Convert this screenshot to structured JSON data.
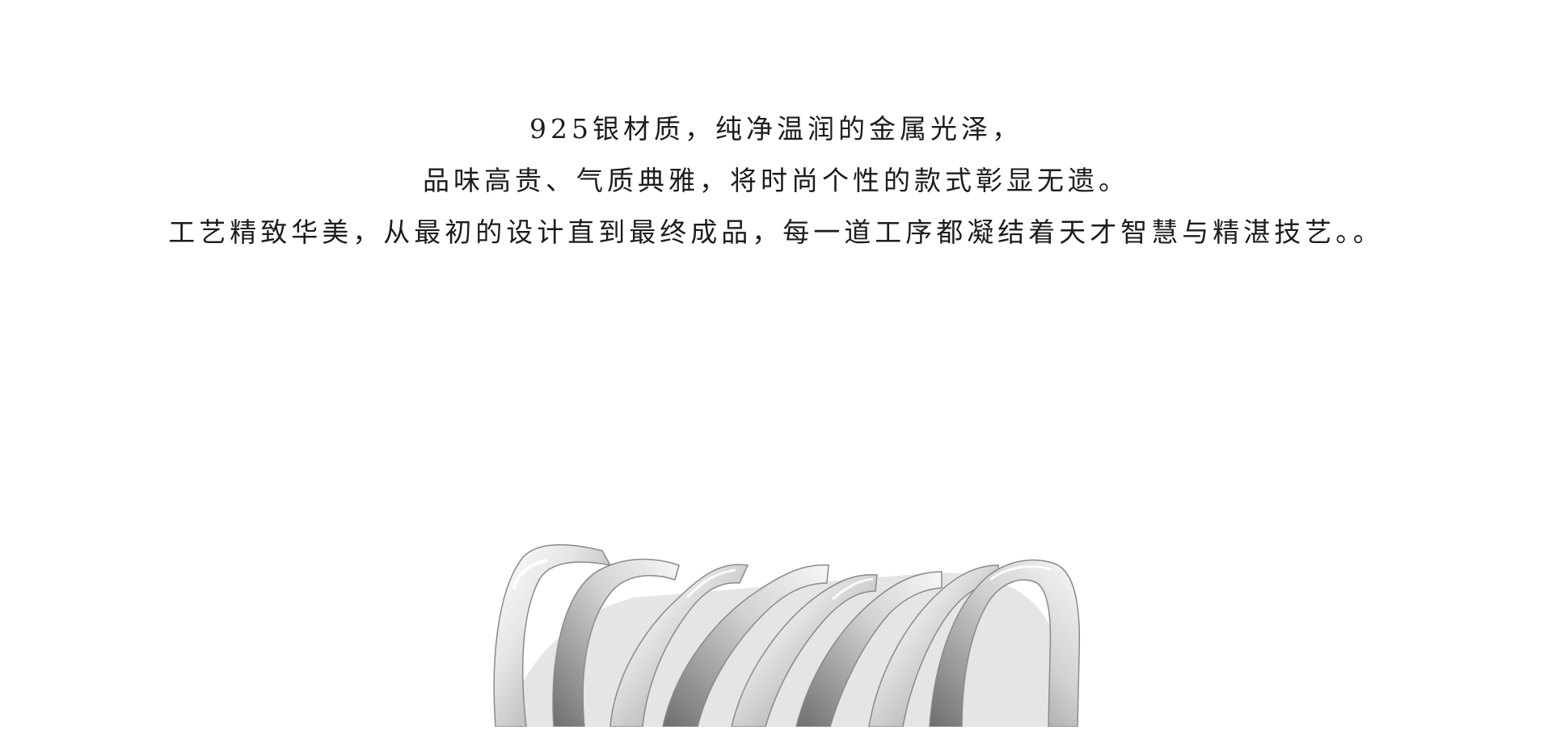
{
  "product_description": {
    "lines": [
      "925银材质，纯净温润的金属光泽，",
      "品味高贵、气质典雅，将时尚个性的款式彰显无遗。",
      "工艺精致华美，从最初的设计直到最终成品，每一道工序都凝结着天才智慧与精湛技艺。。"
    ]
  },
  "product_image": {
    "icon": "silver-wave-ring-icon",
    "colors": {
      "highlight": "#ffffff",
      "silver_light": "#e6e6e6",
      "silver_mid": "#bdbdbd",
      "silver_dark": "#7a7a7a",
      "shadow": "#4f4f4f"
    }
  }
}
